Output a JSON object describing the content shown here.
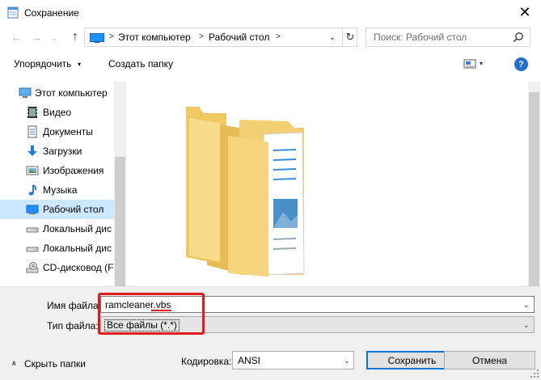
{
  "window": {
    "title": "Сохранение",
    "close": "✕"
  },
  "nav": {
    "back": "←",
    "forward": "→",
    "recent": "⌄",
    "up": "↑",
    "breadcrumb": [
      "Этот компьютер",
      "Рабочий стол"
    ],
    "separator": ">",
    "dropdown": "⌄",
    "refresh": "↻"
  },
  "search": {
    "placeholder": "Поиск: Рабочий стол"
  },
  "toolbar": {
    "organize": "Упорядочить",
    "organize_arrow": "▾",
    "new_folder": "Создать папку",
    "view_arrow": "▾",
    "help": "?"
  },
  "sidebar": {
    "items": [
      {
        "label": "Этот компьютер",
        "icon": "computer-icon"
      },
      {
        "label": "Видео",
        "icon": "video-icon"
      },
      {
        "label": "Документы",
        "icon": "documents-icon"
      },
      {
        "label": "Загрузки",
        "icon": "downloads-icon"
      },
      {
        "label": "Изображения",
        "icon": "pictures-icon"
      },
      {
        "label": "Музыка",
        "icon": "music-icon"
      },
      {
        "label": "Рабочий стол",
        "icon": "desktop-icon",
        "selected": true
      },
      {
        "label": "Локальный дис",
        "icon": "drive-icon"
      },
      {
        "label": "Локальный дис",
        "icon": "drive-icon"
      },
      {
        "label": "CD-дисковод (F",
        "icon": "cd-drive-icon"
      }
    ]
  },
  "form": {
    "filename_label": "Имя файла:",
    "filename_value": "ramcleaner.vbs",
    "filetype_label": "Тип файла:",
    "filetype_value": "Все файлы  (*.*)",
    "dropdown_arrow": "⌄"
  },
  "footer": {
    "hide_folders": "Скрыть папки",
    "hide_arrow": "∧",
    "encoding_label": "Кодировка:",
    "encoding_value": "ANSI",
    "save": "Сохранить",
    "cancel": "Отмена"
  },
  "colors": {
    "accent": "#0078d7",
    "highlight": "#e11c1c",
    "folder": "#f3cf74",
    "selection": "#cce8ff"
  }
}
